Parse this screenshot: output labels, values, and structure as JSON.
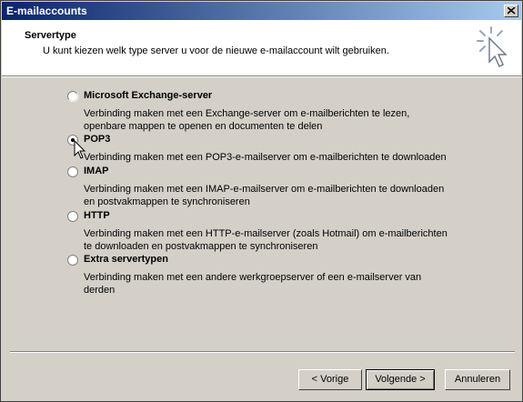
{
  "window": {
    "title": "E-mailaccounts"
  },
  "header": {
    "title": "Servertype",
    "description": "U kunt kiezen welk type server u voor de nieuwe e-mailaccount wilt gebruiken."
  },
  "options": [
    {
      "label": "Microsoft Exchange-server",
      "description": "Verbinding maken met een Exchange-server om e-mailberichten te lezen,\nopenbare mappen te openen en documenten te delen",
      "selected": false
    },
    {
      "label": "POP3",
      "description": "Verbinding maken met een POP3-e-mailserver om e-mailberichten te downloaden",
      "selected": true
    },
    {
      "label": "IMAP",
      "description": "Verbinding maken met een IMAP-e-mailserver om e-mailberichten te downloaden\nen postvakmappen te synchroniseren",
      "selected": false
    },
    {
      "label": "HTTP",
      "description": "Verbinding maken met een HTTP-e-mailserver (zoals Hotmail) om e-mailberichten\nte downloaden en postvakmappen te synchroniseren",
      "selected": false
    },
    {
      "label": "Extra servertypen",
      "description": "Verbinding maken met een andere werkgroepserver of een e-mailserver van\nderden",
      "selected": false
    }
  ],
  "buttons": {
    "back": "< Vorige",
    "next": "Volgende >",
    "cancel": "Annuleren"
  },
  "icons": {
    "close": "close-icon",
    "wizard": "wizard-sparkle-cursor-icon",
    "pointer": "mouse-pointer-icon"
  },
  "colors": {
    "titlebar_start": "#0a246a",
    "titlebar_end": "#a6caf0",
    "face": "#d4d0c8"
  }
}
